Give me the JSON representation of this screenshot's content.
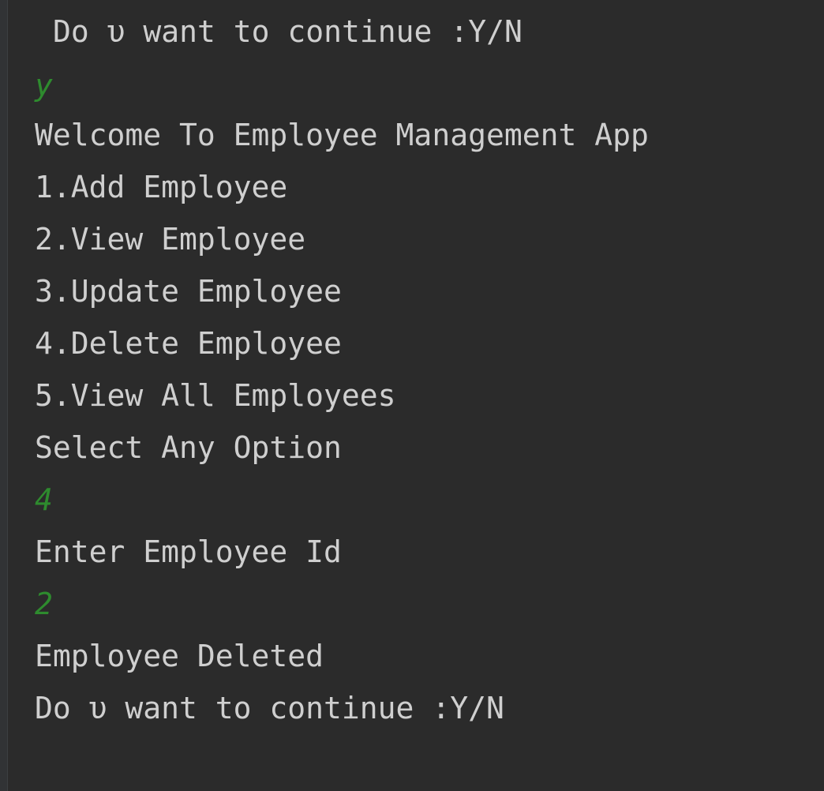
{
  "console": {
    "lines": [
      {
        "text": "Do υ want to continue :Y/N",
        "kind": "output"
      },
      {
        "text": "y",
        "kind": "input"
      },
      {
        "text": "Welcome To Employee Management App",
        "kind": "output"
      },
      {
        "text": "1.Add Employee",
        "kind": "output"
      },
      {
        "text": "2.View Employee",
        "kind": "output"
      },
      {
        "text": "3.Update Employee",
        "kind": "output"
      },
      {
        "text": "4.Delete Employee",
        "kind": "output"
      },
      {
        "text": "5.View All Employees",
        "kind": "output"
      },
      {
        "text": "Select Any Option",
        "kind": "output"
      },
      {
        "text": "4",
        "kind": "input"
      },
      {
        "text": "Enter Employee Id",
        "kind": "output"
      },
      {
        "text": "2",
        "kind": "input"
      },
      {
        "text": "Employee Deleted",
        "kind": "output"
      },
      {
        "text": "Do υ want to continue :Y/N",
        "kind": "output"
      }
    ]
  },
  "colors": {
    "background": "#2b2b2b",
    "output_text": "#cfcfcf",
    "input_text": "#2e8b2e"
  }
}
